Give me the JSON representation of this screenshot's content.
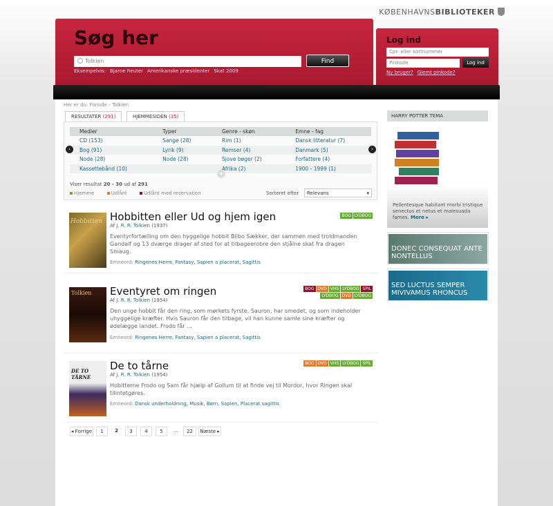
{
  "brand": {
    "prefix": "KØBENHAVNS",
    "suffix": "BIBLIOTEKER"
  },
  "search": {
    "title": "Søg her",
    "value": "Tolkien",
    "button": "Find",
    "examples_label": "Eksempelvis:",
    "examples": [
      "Bjarne Reuter",
      "Amerikanske præsidenter",
      "Skat 2009"
    ]
  },
  "login": {
    "title": "Log ind",
    "card_placeholder": "Cpr- eller kortnummer",
    "pin_placeholder": "Pinkode",
    "button": "Log ind",
    "new_user": "Ny bruger?",
    "forgot_pin": "Glemt pinkode?"
  },
  "breadcrumb": "Her er du: Forside › Tolkien",
  "tabs": [
    {
      "label": "RESULTATER",
      "count": "(291)"
    },
    {
      "label": "HJEMMESIDEN",
      "count": "(35)"
    }
  ],
  "facets": {
    "headers": [
      "Medier",
      "Typer",
      "Genre - skøn",
      "Emne - fag"
    ],
    "rows": [
      [
        "CD (153)",
        "Sange (28)",
        "Rim (1)",
        "Dansk litteratur (7)"
      ],
      [
        "Bog (91)",
        "Lyrik (9)",
        "Remser (4)",
        "Danmark (5)"
      ],
      [
        "Node (28)",
        "Node (28)",
        "Sjove bøger (2)",
        "Forfattere (4)"
      ],
      [
        "Kassettebånd (10)",
        "",
        "Afrika (2)",
        "1900 - 1999 (1)"
      ]
    ]
  },
  "result_count": {
    "prefix": "Viser resultat",
    "range": "20 - 30",
    "of": "ud af",
    "total": "291"
  },
  "legend": [
    {
      "label": "Hjemme",
      "color": "#6aaa3a"
    },
    {
      "label": "Udlånt",
      "color": "#e07a30"
    },
    {
      "label": "Udlånt med reservation",
      "color": "#8a1030"
    }
  ],
  "sort": {
    "label": "Sorteret efter",
    "value": "Relevans"
  },
  "results": [
    {
      "title": "Hobbitten eller Ud og hjem igen",
      "author_prefix": "Af",
      "author": "J. R. R. Tolkien",
      "year": "(1937)",
      "description": "Eventyrfortælling om den hyggelige hobbit Bilbo Sækker, der sammen med troldmanden Gandalf og 13 dværge drager af sted for at tilbageerobre den stjålne skat fra dragen Smaug.",
      "tags_label": "Emneord:",
      "tags": "Ringenes Herre, Fantasy, Sapien a placerat, Sagittis",
      "cover_text": "Hobbitten",
      "badges_row1": [
        {
          "t": "BOG",
          "c": "#6aaa3a"
        },
        {
          "t": "LYDBOG",
          "c": "#6aaa3a"
        }
      ],
      "badges_row2": []
    },
    {
      "title": "Eventyret om ringen",
      "author_prefix": "Af",
      "author": "J. R. R. Tolkien",
      "year": "(1954)",
      "description": "Den unge hobbit får den ring, som mørkets fyrste, Sauron, har smedet, og som indeholder uhyggelige kræfter. Hvis Sauron får den tilbage, vil han kunne samle sine kræfter og ødelægge landet. Frodo får ...",
      "tags_label": "Emneord:",
      "tags": "Ringenes Herre, Fantasy, Sapien a placerat, Sagittis",
      "cover_text": "Tolkien",
      "badges_row1": [
        {
          "t": "BOG",
          "c": "#8a1030"
        },
        {
          "t": "DVD",
          "c": "#e07a30"
        },
        {
          "t": "VHS",
          "c": "#6aaa3a"
        },
        {
          "t": "LYDBOG",
          "c": "#6aaa3a"
        },
        {
          "t": "SPIL",
          "c": "#8a1030"
        }
      ],
      "badges_row2": [
        {
          "t": "LYDBOG",
          "c": "#6aaa3a"
        },
        {
          "t": "DVD",
          "c": "#e07a30"
        },
        {
          "t": "LYDBOG",
          "c": "#6aaa3a"
        }
      ]
    },
    {
      "title": "De to tårne",
      "author_prefix": "Af",
      "author": "J. R. R. Tolkien",
      "year": "(1954)",
      "description": "Hobitterne Frodo og Sam får hjælp af Gollum til at finde vej til Mordor, hvor Ringen skal tilintetgøres.",
      "tags_label": "Emneord:",
      "tags": "Dansk underholdning, Musik, Børn, Sapien, Placerat sagittis",
      "cover_text": "DE TO TÅRNE",
      "badges_row1": [
        {
          "t": "BOG",
          "c": "#e07a30"
        },
        {
          "t": "DVD",
          "c": "#e07a30"
        },
        {
          "t": "VHS",
          "c": "#6aaa3a"
        },
        {
          "t": "LYDBOG",
          "c": "#6aaa3a"
        },
        {
          "t": "SPIL",
          "c": "#6aaa3a"
        }
      ],
      "badges_row2": []
    }
  ],
  "pager": {
    "prev": "◂ Forrige",
    "pages": [
      "1",
      "2",
      "3",
      "4",
      "5",
      "...",
      "22"
    ],
    "current": "2",
    "next": "Næste ▸"
  },
  "sidebar": {
    "head": "HARRY POTTER TEMA",
    "text": "Pellentesque habitant morbi tristique senectus et netus et malesuada fames.",
    "more": "Mere ▸",
    "promo1": "DONEC CONSEQUAT ANTE NONTELLUS",
    "promo2": "SED LUCTUS SEMPER MIVIVAMUS RHONCUS"
  }
}
